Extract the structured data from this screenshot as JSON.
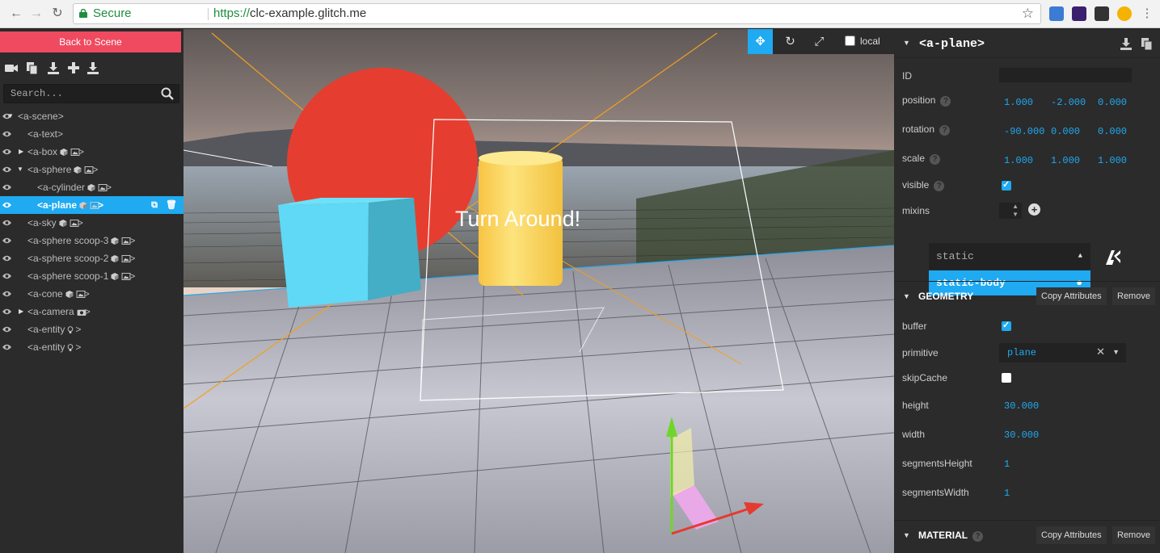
{
  "browser": {
    "secure_label": "Secure",
    "url_scheme": "https://",
    "url_host": "clc-example.glitch.me"
  },
  "left_panel": {
    "back_button": "Back to Scene",
    "search_placeholder": "Search...",
    "tree": [
      {
        "label": "<a-scene>",
        "indent": 0,
        "caret": "down",
        "icons": []
      },
      {
        "label": "<a-text>",
        "indent": 1,
        "caret": "none",
        "icons": []
      },
      {
        "label": "<a-box",
        "indent": 1,
        "caret": "right",
        "icons": [
          "cube",
          "image"
        ],
        "close": ">"
      },
      {
        "label": "<a-sphere",
        "indent": 1,
        "caret": "down",
        "icons": [
          "cube",
          "image"
        ],
        "close": ">"
      },
      {
        "label": "<a-cylinder",
        "indent": 2,
        "caret": "none",
        "icons": [
          "cube",
          "image"
        ],
        "close": ">"
      },
      {
        "label": "<a-plane",
        "indent": 2,
        "caret": "none",
        "icons": [
          "cube",
          "image"
        ],
        "close": ">",
        "selected": true
      },
      {
        "label": "<a-sky",
        "indent": 1,
        "caret": "none",
        "icons": [
          "cube",
          "image"
        ],
        "close": ">"
      },
      {
        "label": "<a-sphere scoop-3",
        "indent": 1,
        "caret": "none",
        "icons": [
          "cube",
          "image"
        ],
        "close": ">"
      },
      {
        "label": "<a-sphere scoop-2",
        "indent": 1,
        "caret": "none",
        "icons": [
          "cube",
          "image"
        ],
        "close": ">"
      },
      {
        "label": "<a-sphere scoop-1",
        "indent": 1,
        "caret": "none",
        "icons": [
          "cube",
          "image"
        ],
        "close": ">"
      },
      {
        "label": "<a-cone",
        "indent": 1,
        "caret": "none",
        "icons": [
          "cube",
          "image"
        ],
        "close": ">"
      },
      {
        "label": "<a-camera",
        "indent": 1,
        "caret": "right",
        "icons": [
          "camera"
        ],
        "close": ">"
      },
      {
        "label": "<a-entity",
        "indent": 1,
        "caret": "none",
        "icons": [
          "bulb"
        ],
        "close": ">"
      },
      {
        "label": "<a-entity",
        "indent": 1,
        "caret": "none",
        "icons": [
          "bulb"
        ],
        "close": ">"
      }
    ]
  },
  "viewport": {
    "scene_text": "Turn Around!",
    "local_label": "local"
  },
  "inspector": {
    "entity_name": "<a-plane>",
    "props": {
      "id_label": "ID",
      "position_label": "position",
      "position": [
        "1.000",
        "-2.000",
        "0.000"
      ],
      "rotation_label": "rotation",
      "rotation": [
        "-90.000",
        "0.000",
        "0.000"
      ],
      "scale_label": "scale",
      "scale": [
        "1.000",
        "1.000",
        "1.000"
      ],
      "visible_label": "visible",
      "mixins_label": "mixins"
    },
    "component_dropdown": {
      "input_value": "static",
      "option": "static-body"
    },
    "geometry": {
      "title": "GEOMETRY",
      "copy_button": "Copy Attributes",
      "remove_button": "Remove",
      "buffer_label": "buffer",
      "primitive_label": "primitive",
      "primitive_value": "plane",
      "skipcache_label": "skipCache",
      "height_label": "height",
      "height_value": "30.000",
      "width_label": "width",
      "width_value": "30.000",
      "seg_h_label": "segmentsHeight",
      "seg_h_value": "1",
      "seg_w_label": "segmentsWidth",
      "seg_w_value": "1"
    },
    "material": {
      "title": "MATERIAL",
      "copy_button": "Copy Attributes",
      "remove_button": "Remove"
    }
  },
  "colors": {
    "accent": "#1faaf2",
    "back_button": "#ef4a60",
    "panel": "#2b2b2b",
    "sphere": "#e53e30",
    "cube": "#5fd9f5",
    "cylinder": "#fcd85d"
  }
}
